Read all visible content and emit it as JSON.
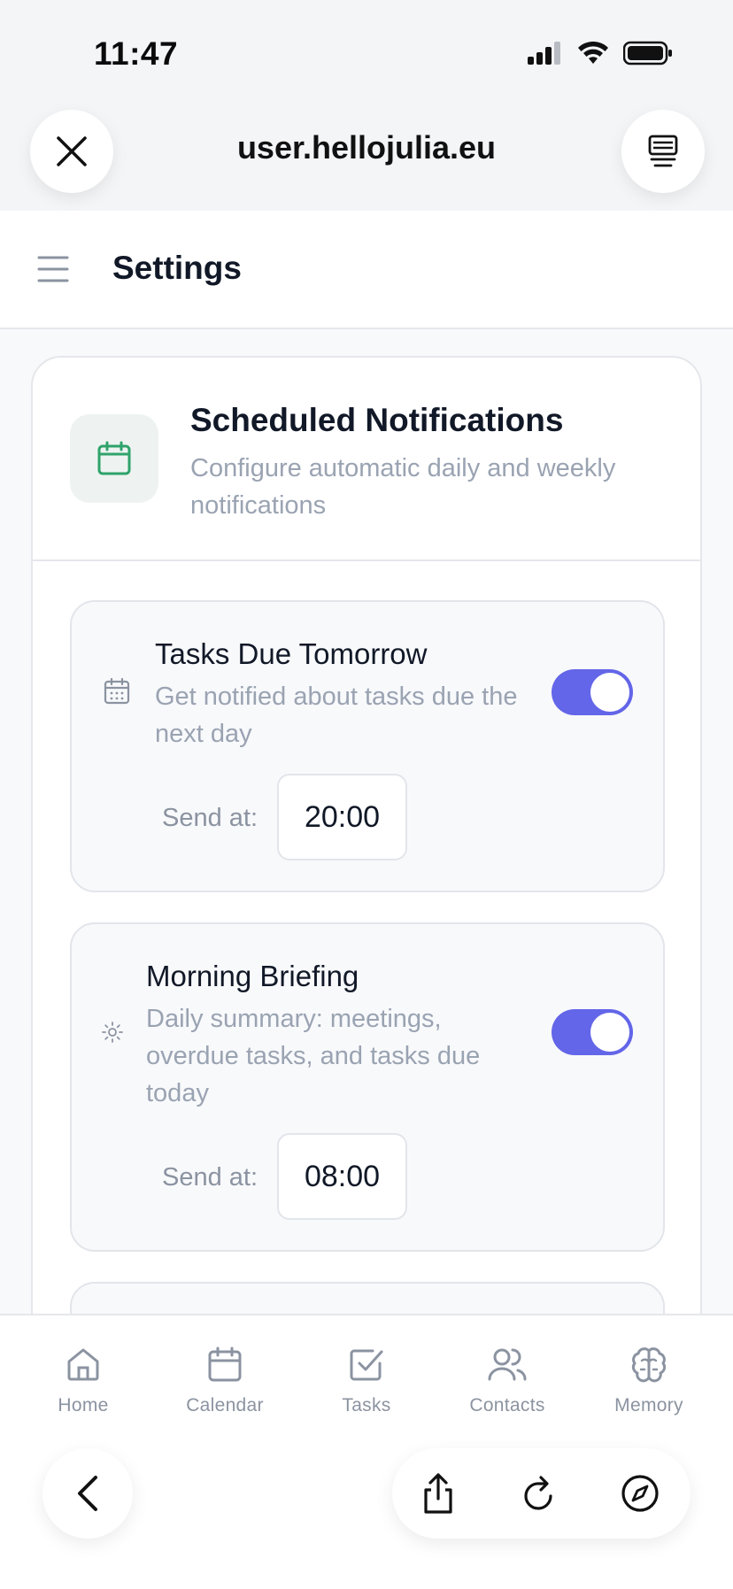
{
  "status_bar": {
    "time": "11:47"
  },
  "browser": {
    "url": "user.hellojulia.eu"
  },
  "header": {
    "title": "Settings"
  },
  "card": {
    "title": "Scheduled Notifications",
    "subtitle": "Configure automatic daily and weekly notifications",
    "icon": "calendar-icon",
    "accent": "#2fa36b"
  },
  "notifications": [
    {
      "title": "Tasks Due Tomorrow",
      "description": "Get notified about tasks due the next day",
      "icon": "calendar-grid-icon",
      "enabled": true,
      "send_label": "Send at:",
      "time": "20:00"
    },
    {
      "title": "Morning Briefing",
      "description": "Daily summary: meetings, overdue tasks, and tasks due today",
      "icon": "sun-icon",
      "enabled": true,
      "send_label": "Send at:",
      "time": "08:00"
    }
  ],
  "colors": {
    "toggle_on": "#6366e8",
    "muted_text": "#9aa3b2"
  },
  "bottom_nav": [
    {
      "label": "Home",
      "icon": "home-icon"
    },
    {
      "label": "Calendar",
      "icon": "calendar-icon"
    },
    {
      "label": "Tasks",
      "icon": "checkbox-icon"
    },
    {
      "label": "Contacts",
      "icon": "users-icon"
    },
    {
      "label": "Memory",
      "icon": "brain-icon"
    }
  ]
}
